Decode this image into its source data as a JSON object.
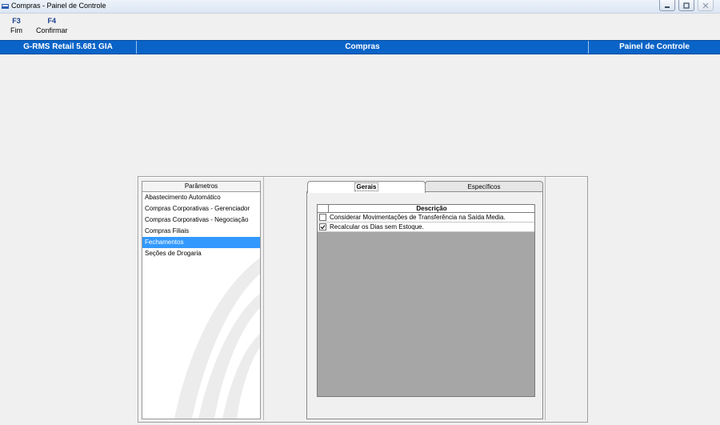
{
  "window": {
    "title": "Compras - Painel de Controle"
  },
  "toolbar": [
    {
      "key": "F3",
      "label": "Fim"
    },
    {
      "key": "F4",
      "label": "Confirmar"
    }
  ],
  "statusbar": {
    "left": "G-RMS Retail 5.681 GIA",
    "center": "Compras",
    "right": "Painel de Controle"
  },
  "parameters": {
    "header": "Parâmetros",
    "items": [
      "Abastecimento Automático",
      "Compras Corporativas - Gerenciador",
      "Compras Corporativas - Negociação",
      "Compras Filiais",
      "Fechamentos",
      "Seções de Drogaria"
    ],
    "selected_index": 4
  },
  "tabs": {
    "items": [
      "Gerais",
      "Específicos"
    ],
    "active_index": 0
  },
  "grid": {
    "header": "Descrição",
    "rows": [
      {
        "checked": false,
        "text": "Considerar Movimentações de Transferência na Saída Media."
      },
      {
        "checked": true,
        "text": "Recalcular os Dias sem Estoque."
      }
    ]
  },
  "colors": {
    "accent": "#0a64c8",
    "selection": "#3399ff",
    "grid_empty": "#a6a6a6"
  }
}
